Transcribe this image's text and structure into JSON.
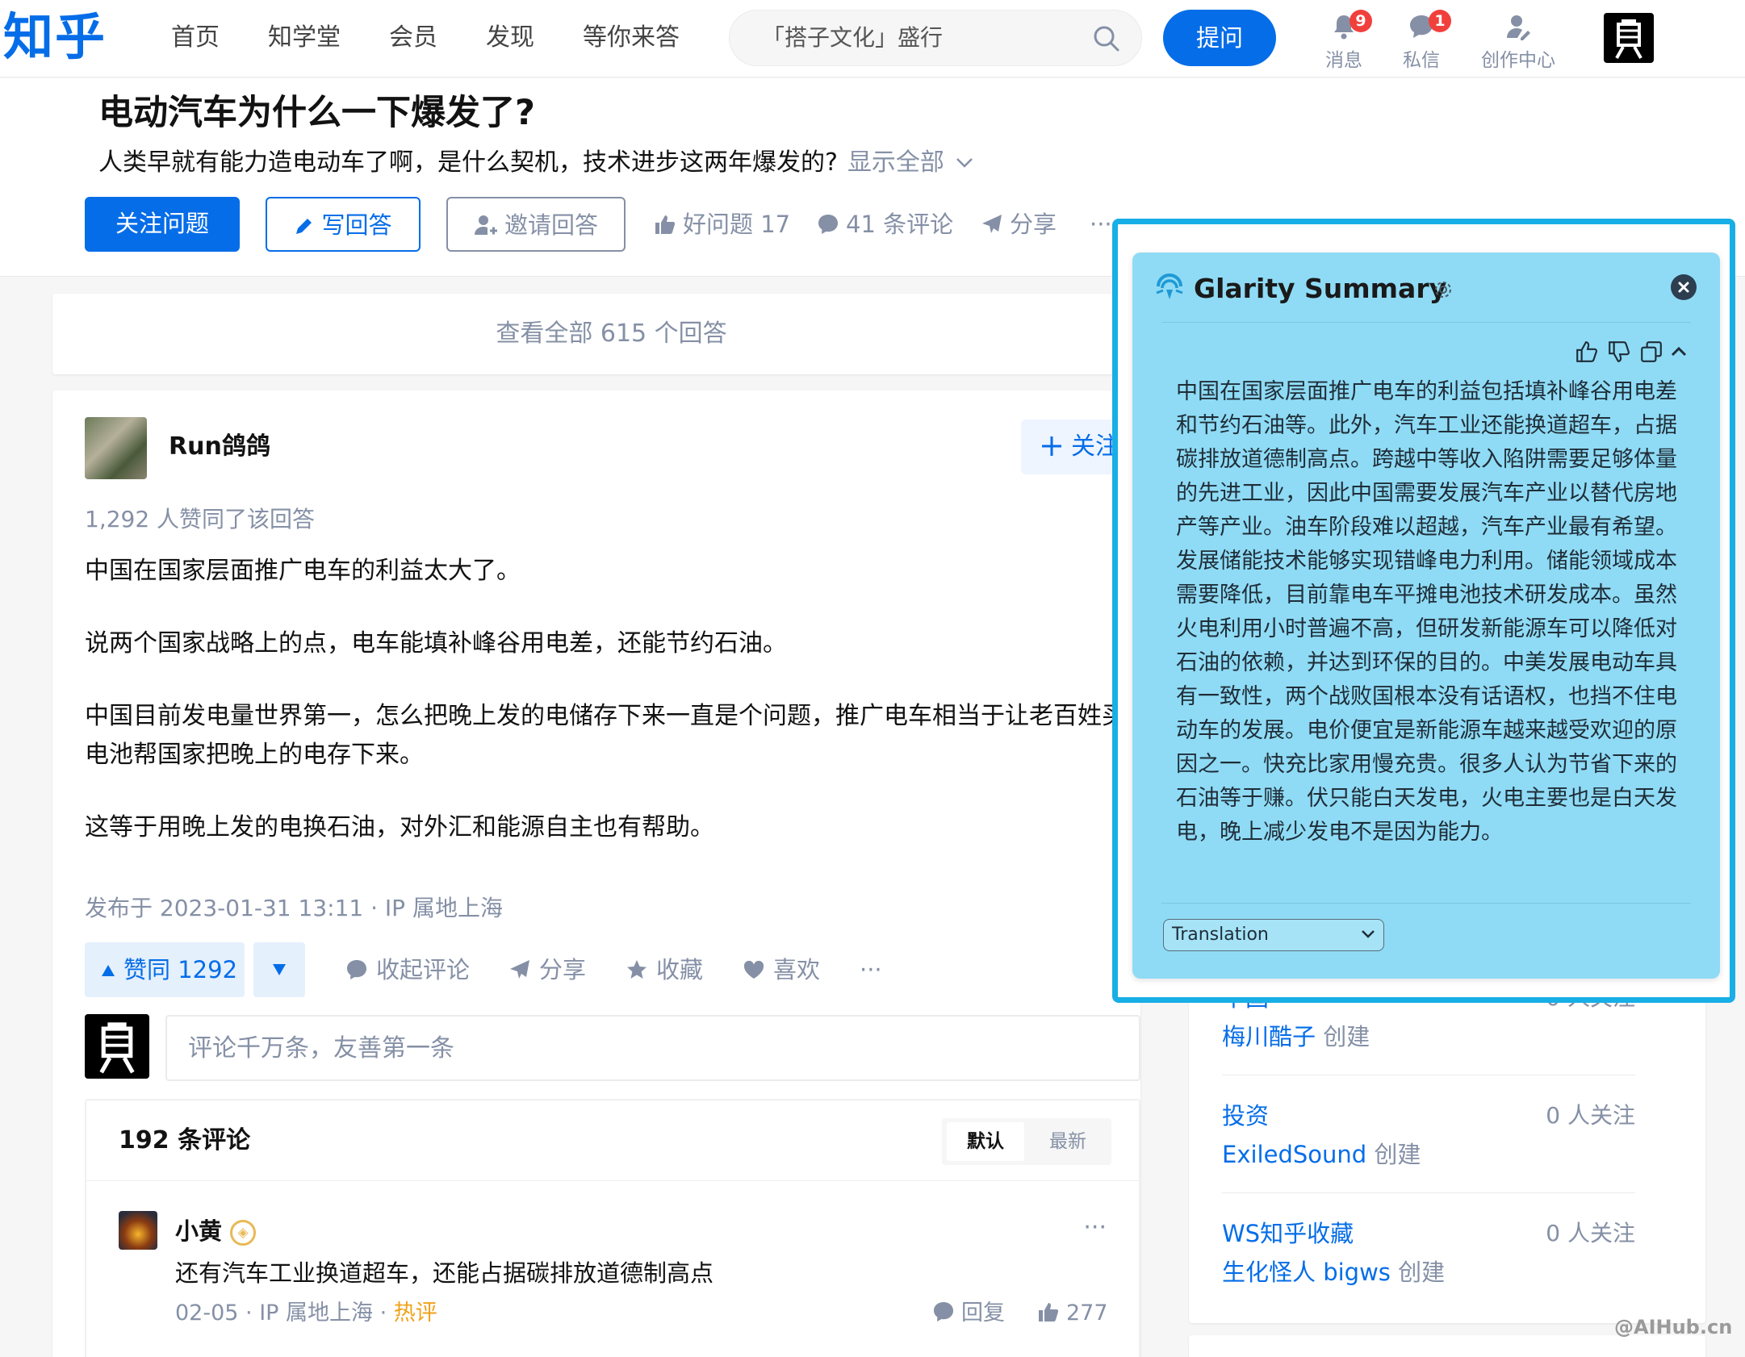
{
  "header": {
    "logo": "知乎",
    "nav": [
      "首页",
      "知学堂",
      "会员",
      "发现",
      "等你来答"
    ],
    "search_text": "「搭子文化」盛行",
    "ask_label": "提问",
    "messages": {
      "label": "消息",
      "badge": "9"
    },
    "dm": {
      "label": "私信",
      "badge": "1"
    },
    "creator_label": "创作中心"
  },
  "question": {
    "title": "电动汽车为什么一下爆发了?",
    "description": "人类早就有能力造电动车了啊，是什么契机，技术进步这两年爆发的?",
    "show_all": "显示全部",
    "follow_label": "关注问题",
    "write_label": "写回答",
    "invite_label": "邀请回答",
    "good_question": "好问题 17",
    "comments": "41 条评论",
    "share": "分享",
    "more": "···"
  },
  "view_all": "查看全部 615 个回答",
  "answer": {
    "author": "Run鸽鸽",
    "follow_label": "关注",
    "likes_summary": "1,292 人赞同了该回答",
    "paragraphs": [
      "中国在国家层面推广电车的利益太大了。",
      "说两个国家战略上的点，电车能填补峰谷用电差，还能节约石油。",
      "中国目前发电量世界第一，怎么把晚上发的电储存下来一直是个问题，推广电车相当于让老百姓买",
      "电池帮国家把晚上的电存下来。",
      "这等于用晚上发的电换石油，对外汇和能源自主也有帮助。"
    ],
    "meta": "发布于 2023-01-31 13:11 · IP 属地上海",
    "vote_label": "赞同 1292",
    "actions": [
      "收起评论",
      "分享",
      "收藏",
      "喜欢",
      "···"
    ],
    "comment_placeholder": "评论千万条，友善第一条"
  },
  "comments": {
    "count_label": "192 条评论",
    "sort_default": "默认",
    "sort_latest": "最新",
    "items": [
      {
        "name": "小黄",
        "text": "还有汽车工业换道超车，还能占据碳排放道德制高点",
        "meta_date": "02-05",
        "meta_ip": "IP 属地上海",
        "hot": "热评",
        "reply": "回复",
        "likes": "277",
        "more": "···"
      }
    ]
  },
  "collections": [
    {
      "title": "中国",
      "count": "0 人关注",
      "creator": "梅川酷子",
      "created": "创建"
    },
    {
      "title": "投资",
      "count": "0 人关注",
      "creator": "ExiledSound",
      "created": "创建"
    },
    {
      "title": "WS知乎收藏",
      "count": "0 人关注",
      "creator": "生化怪人 bigws",
      "created": "创建"
    }
  ],
  "glarity": {
    "title": "Glarity Summary",
    "summary": "中国在国家层面推广电车的利益包括填补峰谷用电差和节约石油等。此外，汽车工业还能换道超车，占据碳排放道德制高点。跨越中等收入陷阱需要足够体量的先进工业，因此中国需要发展汽车产业以替代房地产等产业。油车阶段难以超越，汽车产业最有希望。发展储能技术能够实现错峰电力利用。储能领域成本需要降低，目前靠电车平摊电池技术研发成本。虽然火电利用小时普遍不高，但研发新能源车可以降低对石油的依赖，并达到环保的目的。中美发展电动车具有一致性，两个战败国根本没有话语权，也挡不住电动车的发展。电价便宜是新能源车越来越受欢迎的原因之一。快充比家用慢充贵。很多人认为节省下来的石油等于赚。伏只能白天发电，火电主要也是白天发电，晚上减少发电不是因为能力。",
    "select_value": "Translation"
  },
  "watermark": "@AIHub.cn",
  "colors": {
    "brand": "#056de8",
    "glarity_bg": "#8fdbf5",
    "glarity_border": "#18aee6",
    "badge": "#f1403c",
    "hot": "#f0a21a"
  }
}
